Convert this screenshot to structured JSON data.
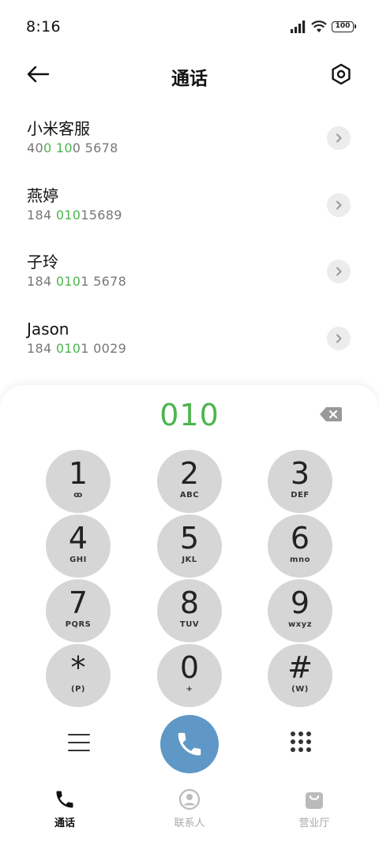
{
  "status_bar": {
    "time": "8:16",
    "battery": "100"
  },
  "header": {
    "title": "通话"
  },
  "results": [
    {
      "name": "小米客服",
      "number_parts": [
        "40",
        "0 10",
        "0 5678"
      ]
    },
    {
      "name": "燕婷",
      "number_parts": [
        "184 ",
        "010",
        "15689"
      ]
    },
    {
      "name": "子玲",
      "number_parts": [
        "184 ",
        "010",
        "1 5678"
      ]
    },
    {
      "name": "Jason",
      "number_parts": [
        "184 ",
        "010",
        "1 0029"
      ]
    }
  ],
  "dialer": {
    "dialed": "010",
    "keys": [
      {
        "digit": "1",
        "letters": "ꝏ"
      },
      {
        "digit": "2",
        "letters": "ABC"
      },
      {
        "digit": "3",
        "letters": "DEF"
      },
      {
        "digit": "4",
        "letters": "GHI"
      },
      {
        "digit": "5",
        "letters": "JKL"
      },
      {
        "digit": "6",
        "letters": "mno"
      },
      {
        "digit": "7",
        "letters": "PQRS"
      },
      {
        "digit": "8",
        "letters": "TUV"
      },
      {
        "digit": "9",
        "letters": "wxyz"
      },
      {
        "digit": "*",
        "letters": "(P)"
      },
      {
        "digit": "0",
        "letters": "+"
      },
      {
        "digit": "#",
        "letters": "(W)"
      }
    ]
  },
  "bottom_nav": {
    "items": [
      {
        "label": "通话",
        "icon": "phone-icon",
        "active": true
      },
      {
        "label": "联系人",
        "icon": "contact-icon",
        "active": false
      },
      {
        "label": "营业厅",
        "icon": "shopping-bag-icon",
        "active": false
      }
    ]
  },
  "colors": {
    "highlight": "#4cb54f",
    "call_button": "#5f98c6",
    "key_bg": "#d6d6d6"
  }
}
